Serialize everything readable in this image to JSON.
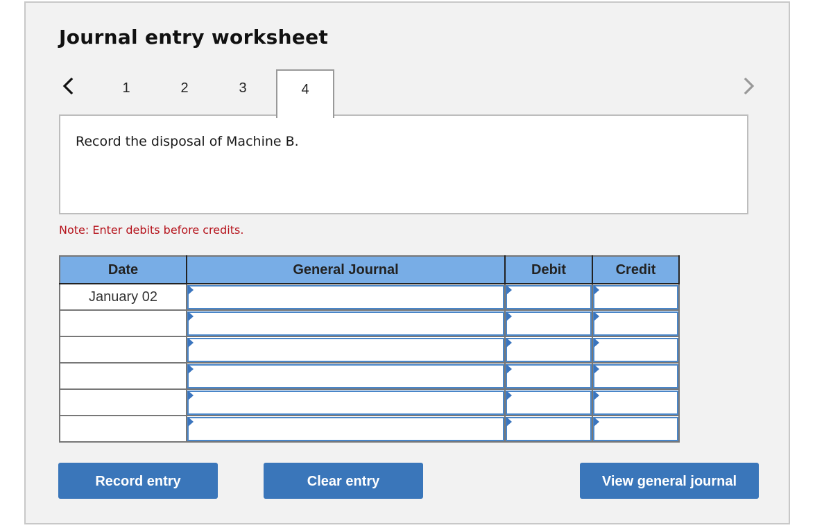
{
  "worksheet": {
    "title": "Journal entry worksheet",
    "nav": {
      "prev_icon": "chevron-left-icon",
      "next_icon": "chevron-right-icon",
      "prev_enabled": true,
      "next_enabled": false
    },
    "tabs": [
      {
        "label": "1",
        "active": false
      },
      {
        "label": "2",
        "active": false
      },
      {
        "label": "3",
        "active": false
      },
      {
        "label": "4",
        "active": true
      }
    ],
    "prompt": "Record the disposal of Machine B.",
    "note": "Note: Enter debits before credits."
  },
  "journal": {
    "headers": {
      "date": "Date",
      "general_journal": "General Journal",
      "debit": "Debit",
      "credit": "Credit"
    },
    "rows": [
      {
        "date": "January 02",
        "account": "",
        "debit": "",
        "credit": ""
      },
      {
        "date": "",
        "account": "",
        "debit": "",
        "credit": ""
      },
      {
        "date": "",
        "account": "",
        "debit": "",
        "credit": ""
      },
      {
        "date": "",
        "account": "",
        "debit": "",
        "credit": ""
      },
      {
        "date": "",
        "account": "",
        "debit": "",
        "credit": ""
      },
      {
        "date": "",
        "account": "",
        "debit": "",
        "credit": ""
      }
    ]
  },
  "buttons": {
    "record": "Record entry",
    "clear": "Clear entry",
    "view": "View general journal"
  },
  "colors": {
    "header_blue": "#78ade6",
    "button_blue": "#3a76ba",
    "note_red": "#b5121b",
    "input_border": "#4a86c8"
  }
}
